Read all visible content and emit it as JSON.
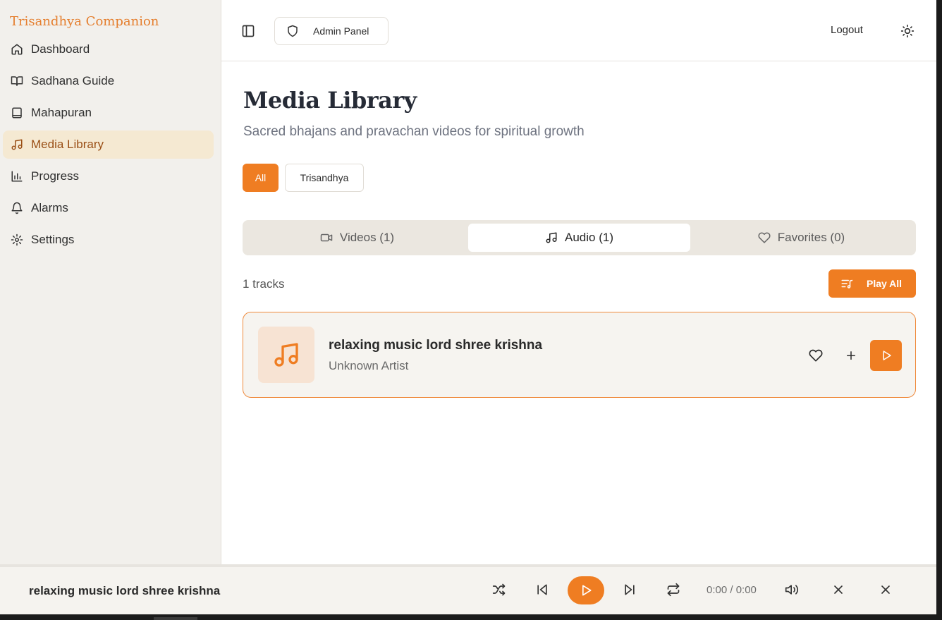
{
  "app": {
    "brand": "Trisandhya Companion"
  },
  "sidebar": {
    "items": [
      {
        "label": "Dashboard",
        "icon": "home-icon"
      },
      {
        "label": "Sadhana Guide",
        "icon": "open-book-icon"
      },
      {
        "label": "Mahapuran",
        "icon": "book-icon"
      },
      {
        "label": "Media Library",
        "icon": "music-note-icon",
        "active": true
      },
      {
        "label": "Progress",
        "icon": "bar-chart-icon"
      },
      {
        "label": "Alarms",
        "icon": "bell-icon"
      },
      {
        "label": "Settings",
        "icon": "gear-icon"
      }
    ]
  },
  "header": {
    "admin_label": "Admin Panel",
    "logout_label": "Logout"
  },
  "main": {
    "title": "Media Library",
    "subtitle": "Sacred bhajans and pravachan videos for spiritual growth",
    "filters": [
      "All",
      "Trisandhya"
    ],
    "active_filter": "All",
    "tabs": [
      {
        "label": "Videos (1)",
        "icon": "video-icon"
      },
      {
        "label": "Audio (1)",
        "icon": "music-note-icon",
        "active": true
      },
      {
        "label": "Favorites (0)",
        "icon": "heart-icon"
      }
    ],
    "track_count": "1 tracks",
    "play_all_label": "Play All",
    "tracks": [
      {
        "title": "relaxing music lord shree krishna",
        "artist": "Unknown Artist"
      }
    ]
  },
  "player": {
    "title": "relaxing music lord shree krishna",
    "time": "0:00 / 0:00"
  },
  "colors": {
    "accent": "#ef7d22",
    "brand": "#e57e2d",
    "sidebar_bg": "#f2f0ec",
    "active_nav_bg": "#f5e9d2"
  }
}
